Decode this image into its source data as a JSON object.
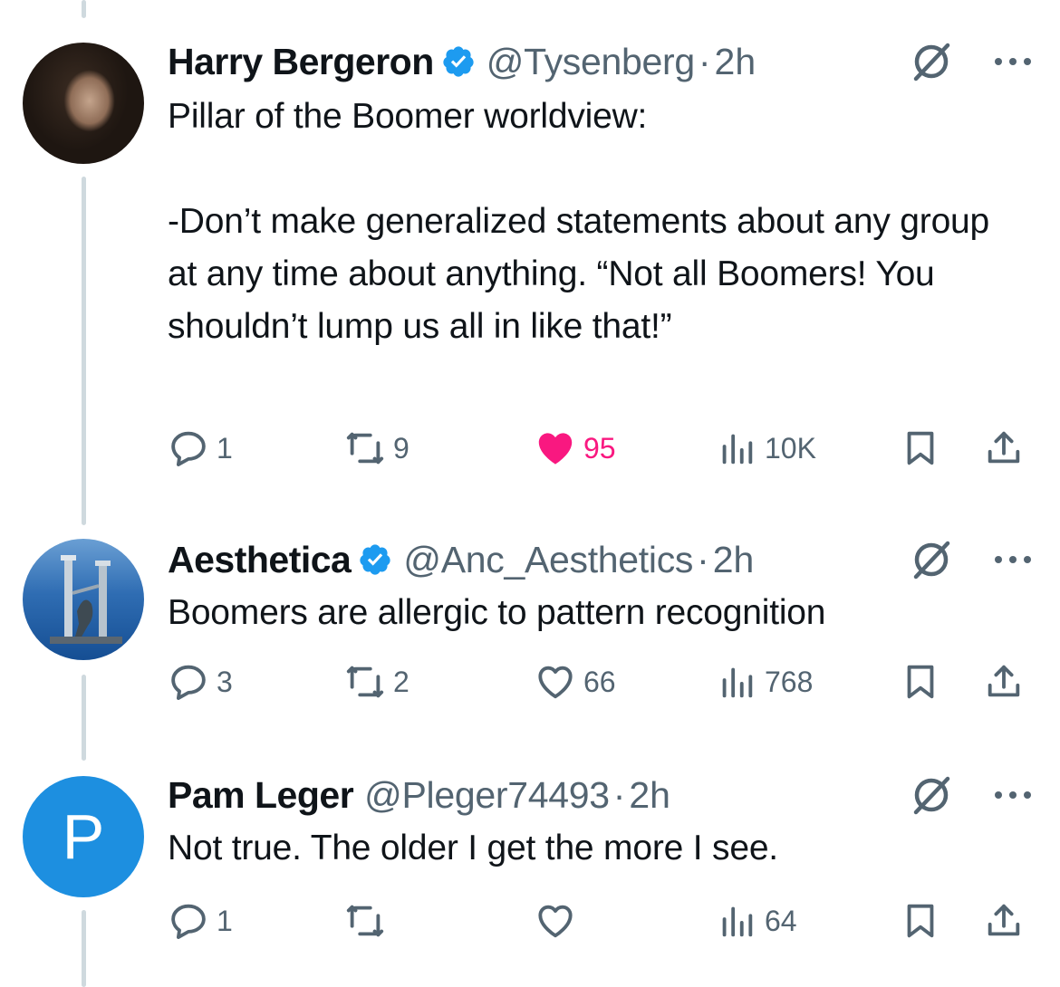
{
  "tweets": [
    {
      "name": "Harry Bergeron",
      "verified": true,
      "handle": "@Tysenberg",
      "separator": "·",
      "time": "2h",
      "text": "Pillar of the Boomer worldview:\n\n-Don’t make generalized statements about any group at any time about anything. “Not all Boomers! You shouldn’t lump us all in like that!”",
      "replies": "1",
      "reposts": "9",
      "likes": "95",
      "liked": true,
      "views": "10K"
    },
    {
      "name": "Aesthetica",
      "verified": true,
      "handle": "@Anc_Aesthetics",
      "separator": "·",
      "time": "2h",
      "text": "Boomers are allergic to pattern recognition",
      "replies": "3",
      "reposts": "2",
      "likes": "66",
      "liked": false,
      "views": "768"
    },
    {
      "name": "Pam Leger",
      "verified": false,
      "avatar_letter": "P",
      "handle": "@Pleger74493",
      "separator": "·",
      "time": "2h",
      "text": "Not true. The older I get the more I see.",
      "replies": "1",
      "reposts": "",
      "likes": "",
      "liked": false,
      "views": "64"
    }
  ],
  "icons": {
    "reply": "speech-bubble-icon",
    "repost": "repost-arrows-icon",
    "like": "heart-icon",
    "views": "bar-chart-icon",
    "bookmark": "bookmark-icon",
    "share": "share-upload-icon",
    "grok": "grok-slash-icon",
    "more": "ellipsis-icon",
    "verified": "verified-badge-icon"
  },
  "colors": {
    "text": "#0f1419",
    "secondary": "#536471",
    "verified_blue": "#1d9bf0",
    "like_pink": "#f91880",
    "thread_line": "#cfd9de",
    "pam_avatar": "#1d8fe0"
  }
}
